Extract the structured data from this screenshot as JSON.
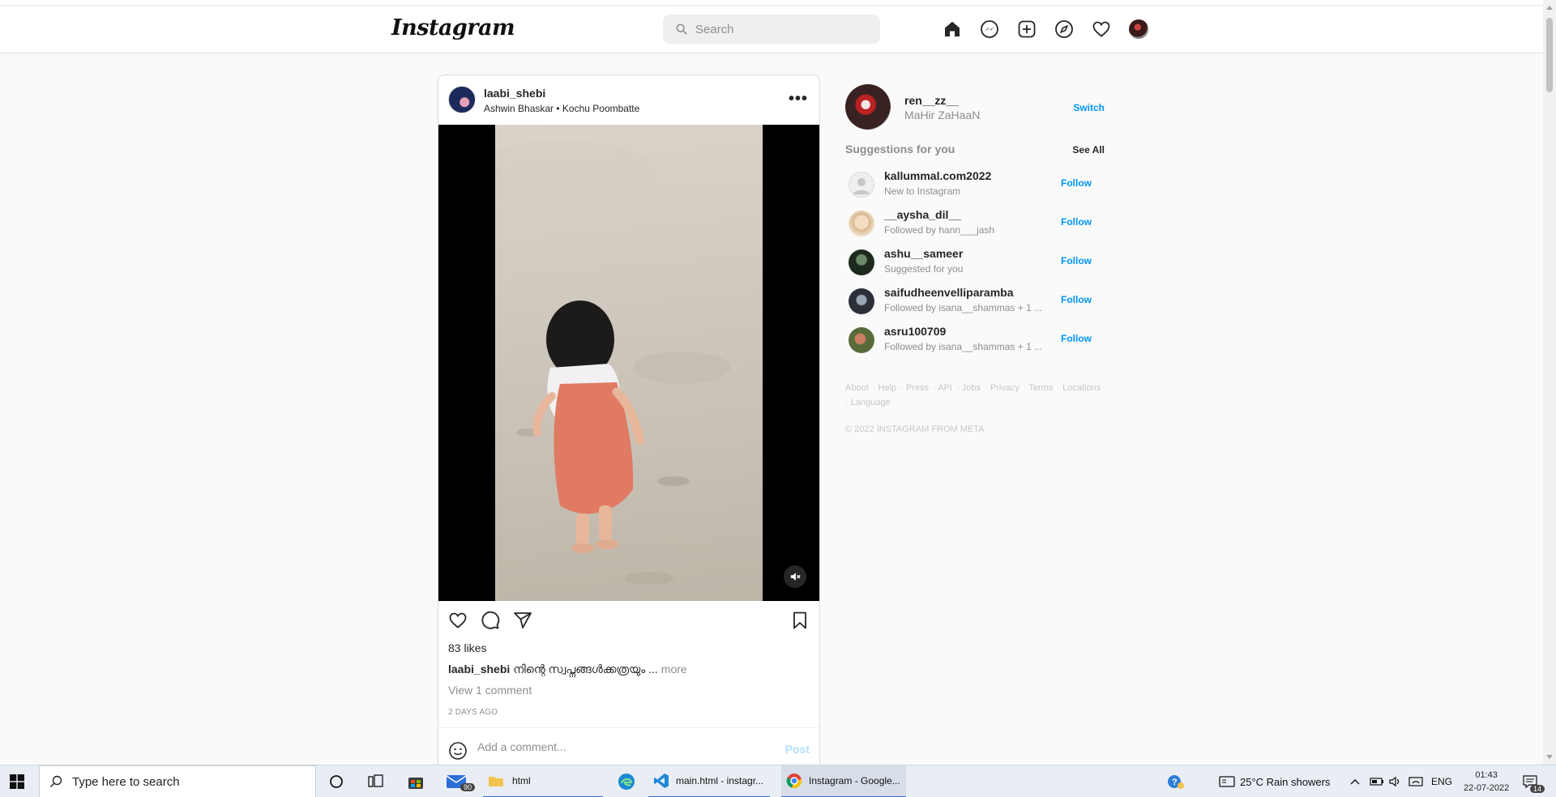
{
  "app": {
    "logo": "Instagram",
    "search_placeholder": "Search"
  },
  "post": {
    "username": "laabi_shebi",
    "subtitle": "Ashwin Bhaskar • Kochu Poombatte",
    "more": "•••",
    "likes": "83 likes",
    "caption_user": "laabi_shebi",
    "caption_text": "നിന്റെ സ്വപ്നങ്ങൾക്കത്രയും ...",
    "caption_more": "more",
    "view_comments": "View 1 comment",
    "time_ago": "2 DAYS AGO",
    "comment_placeholder": "Add a comment...",
    "post_button": "Post"
  },
  "sidebar": {
    "me_username": "ren__zz__",
    "me_name": "MaHir ZaHaaN",
    "switch": "Switch",
    "suggestions_title": "Suggestions for you",
    "see_all": "See All",
    "suggestions": [
      {
        "username": "kallummal.com2022",
        "meta": "New to Instagram",
        "follow": "Follow"
      },
      {
        "username": "__aysha_dil__",
        "meta": "Followed by hann___jash",
        "follow": "Follow"
      },
      {
        "username": "ashu__sameer",
        "meta": "Suggested for you",
        "follow": "Follow"
      },
      {
        "username": "saifudheenvelliparamba",
        "meta": "Followed by isana__shammas + 1 ...",
        "follow": "Follow"
      },
      {
        "username": "asru100709",
        "meta": "Followed by isana__shammas + 1 ...",
        "follow": "Follow"
      }
    ],
    "footer_links": [
      "About",
      "Help",
      "Press",
      "API",
      "Jobs",
      "Privacy",
      "Terms",
      "Locations",
      "Language"
    ],
    "copyright": "© 2022 INSTAGRAM FROM META"
  },
  "taskbar": {
    "search_placeholder": "Type here to search",
    "mail_badge": "90",
    "folder_label": "html",
    "vscode_label": "main.html - instagr...",
    "chrome_label": "Instagram - Google...",
    "weather": "25°C  Rain showers",
    "lang": "ENG",
    "time": "01:43",
    "date": "22-07-2022",
    "notif_count": "14"
  },
  "colors": {
    "accent": "#0095f6",
    "border": "#dbdbdb",
    "muted": "#8e8e8e"
  }
}
